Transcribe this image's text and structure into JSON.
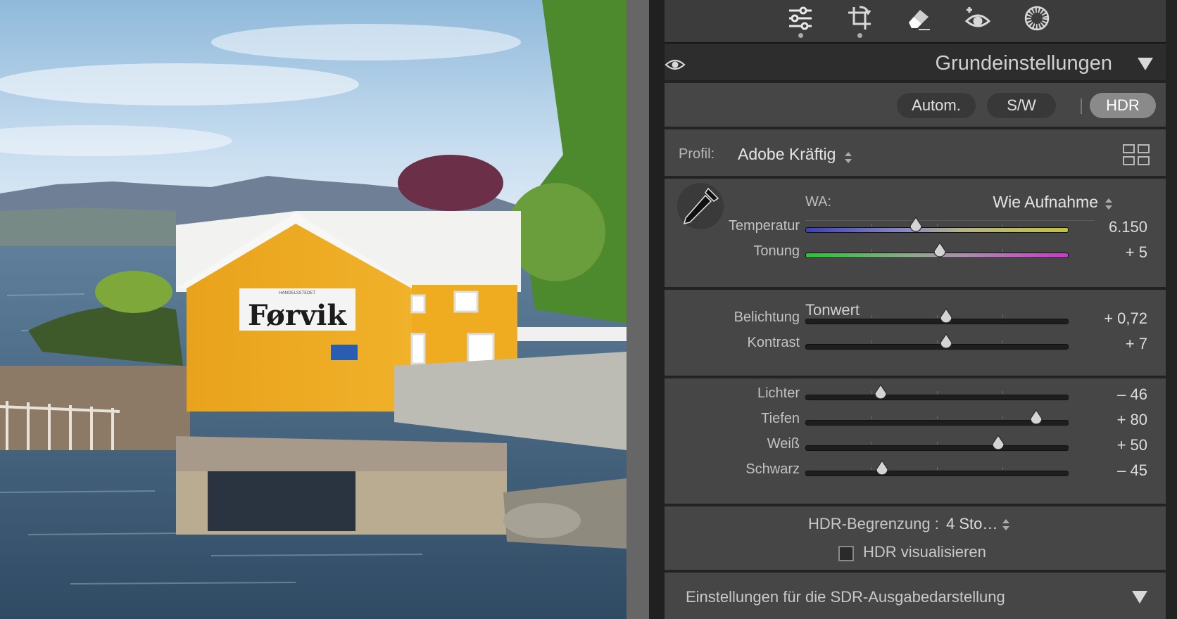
{
  "photo": {
    "sign_text": "Førvik",
    "sign_subtext": "HANDELSSTEDET"
  },
  "toolbar": {
    "tools": [
      "edit-sliders-icon",
      "crop-icon",
      "eraser-icon",
      "redeye-icon",
      "mask-icon"
    ]
  },
  "panel": {
    "title": "Grundeinstellungen",
    "modes": {
      "auto": "Autom.",
      "bw": "S/W",
      "hdr": "HDR",
      "active": "HDR"
    },
    "profile": {
      "label": "Profil:",
      "value": "Adobe Kräftig"
    },
    "white_balance": {
      "label": "WA:",
      "value": "Wie Aufnahme",
      "sliders": [
        {
          "label": "Temperatur",
          "value": "6.150",
          "position": 0.42
        },
        {
          "label": "Tonung",
          "value": "+ 5",
          "position": 0.51
        }
      ]
    },
    "tone": {
      "label": "Tonwert",
      "sliders": [
        {
          "label": "Belichtung",
          "value": "+ 0,72",
          "position": 0.536
        },
        {
          "label": "Kontrast",
          "value": "+ 7",
          "position": 0.536
        }
      ]
    },
    "tone2": {
      "sliders": [
        {
          "label": "Lichter",
          "value": "– 46",
          "position": 0.285
        },
        {
          "label": "Tiefen",
          "value": "+ 80",
          "position": 0.878
        },
        {
          "label": "Weiß",
          "value": "+ 50",
          "position": 0.735
        },
        {
          "label": "Schwarz",
          "value": "– 45",
          "position": 0.29
        }
      ]
    },
    "hdr_limit": {
      "label": "HDR-Begrenzung :",
      "value": "4 Sto…",
      "visualize_label": "HDR visualisieren",
      "visualize_checked": false
    },
    "sdr": {
      "label": "Einstellungen für die SDR-Ausgabedarstellung"
    }
  }
}
